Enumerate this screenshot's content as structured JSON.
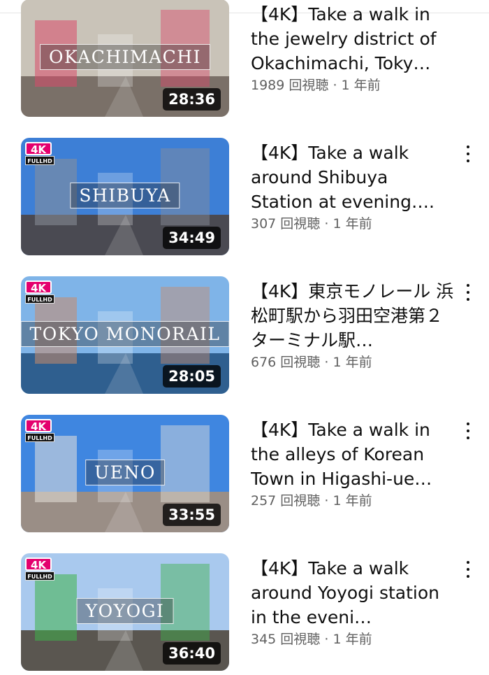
{
  "videos": [
    {
      "caption": "OKACHIMACHI",
      "duration": "28:36",
      "title": "【4K】Take a walk in the jewelry district of Okachimachi, Toky…",
      "views": "1989 回視聴",
      "age": "1 年前"
    },
    {
      "caption": "SHIBUYA",
      "duration": "34:49",
      "title": "【4K】Take a walk around Shibuya Station at evening….",
      "views": "307 回視聴",
      "age": "1 年前"
    },
    {
      "caption": "TOKYO MONORAIL",
      "duration": "28:05",
      "title": "【4K】東京モノレール 浜松町駅から羽田空港第２ターミナル駅…",
      "views": "676 回視聴",
      "age": "1 年前"
    },
    {
      "caption": "UENO",
      "duration": "33:55",
      "title": "【4K】Take a walk in the alleys of Korean Town in Higashi-ue…",
      "views": "257 回視聴",
      "age": "1 年前"
    },
    {
      "caption": "YOYOGI",
      "duration": "36:40",
      "title": "【4K】Take a walk around Yoyogi station in the eveni…",
      "views": "345 回視聴",
      "age": "1 年前"
    }
  ],
  "badge": {
    "top": "4K",
    "bottom": "FULLHD"
  },
  "meta_separator": " · ",
  "thumb_colors": [
    {
      "sky": "#c9c3b8",
      "ground": "#7a7068",
      "accent": "#d94a6a"
    },
    {
      "sky": "#3d7fd6",
      "ground": "#4a4a52",
      "accent": "#8a8f99"
    },
    {
      "sky": "#7fb4e8",
      "ground": "#2f5f8f",
      "accent": "#c98a6a"
    },
    {
      "sky": "#3f86e0",
      "ground": "#9a8e86",
      "accent": "#e7e2da"
    },
    {
      "sky": "#a9c9ee",
      "ground": "#5a5650",
      "accent": "#3fb24a"
    }
  ]
}
